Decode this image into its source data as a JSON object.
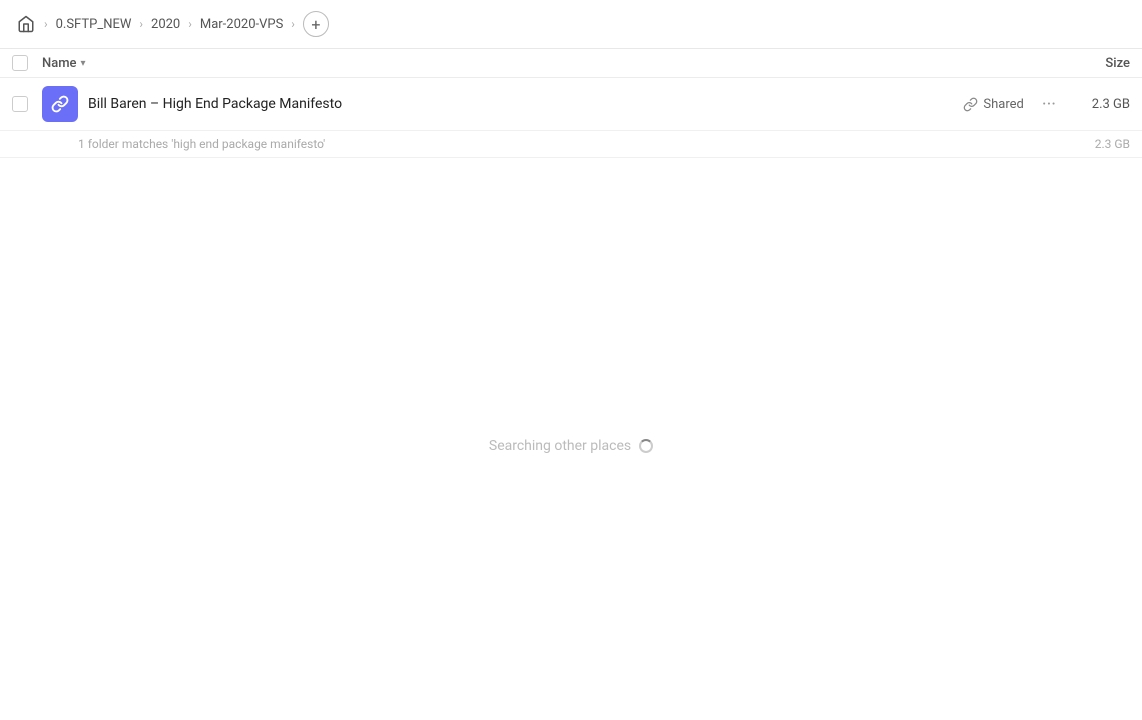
{
  "breadcrumb": {
    "home_icon": "🏠",
    "items": [
      {
        "label": "0.SFTP_NEW"
      },
      {
        "label": "2020"
      },
      {
        "label": "Mar-2020-VPS"
      }
    ],
    "add_icon": "+"
  },
  "columns": {
    "name_label": "Name",
    "size_label": "Size"
  },
  "file": {
    "name": "Bill Baren – High End Package Manifesto",
    "shared_label": "Shared",
    "size": "2.3 GB",
    "more_icon": "···"
  },
  "match_info": {
    "text": "1 folder matches 'high end package manifesto'",
    "size": "2.3 GB"
  },
  "searching": {
    "text": "Searching other places"
  }
}
